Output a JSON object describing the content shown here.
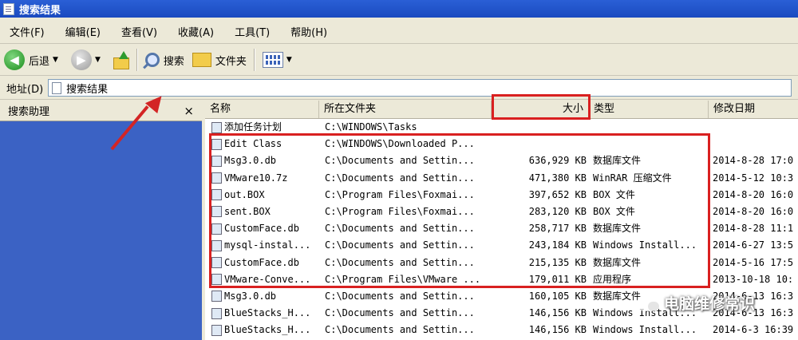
{
  "window": {
    "title": "搜索结果"
  },
  "menu": [
    "文件(F)",
    "编辑(E)",
    "查看(V)",
    "收藏(A)",
    "工具(T)",
    "帮助(H)"
  ],
  "toolbar": {
    "back": "后退",
    "search": "搜索",
    "folders": "文件夹"
  },
  "address": {
    "label": "地址(D)",
    "value": "搜索结果"
  },
  "search_pane": {
    "title": "搜索助理",
    "close": "×"
  },
  "columns": {
    "name": "名称",
    "folder": "所在文件夹",
    "size": "大小",
    "type": "类型",
    "modified": "修改日期"
  },
  "files": [
    {
      "name": "添加任务计划",
      "folder": "C:\\WINDOWS\\Tasks",
      "size": "",
      "type": "",
      "modified": ""
    },
    {
      "name": "Edit Class",
      "folder": "C:\\WINDOWS\\Downloaded P...",
      "size": "",
      "type": "",
      "modified": ""
    },
    {
      "name": "Msg3.0.db",
      "folder": "C:\\Documents and Settin...",
      "size": "636,929 KB",
      "type": "数据库文件",
      "modified": "2014-8-28 17:0"
    },
    {
      "name": "VMware10.7z",
      "folder": "C:\\Documents and Settin...",
      "size": "471,380 KB",
      "type": "WinRAR 压缩文件",
      "modified": "2014-5-12 10:3"
    },
    {
      "name": "out.BOX",
      "folder": "C:\\Program Files\\Foxmai...",
      "size": "397,652 KB",
      "type": "BOX 文件",
      "modified": "2014-8-20 16:0"
    },
    {
      "name": "sent.BOX",
      "folder": "C:\\Program Files\\Foxmai...",
      "size": "283,120 KB",
      "type": "BOX 文件",
      "modified": "2014-8-20 16:0"
    },
    {
      "name": "CustomFace.db",
      "folder": "C:\\Documents and Settin...",
      "size": "258,717 KB",
      "type": "数据库文件",
      "modified": "2014-8-28 11:1"
    },
    {
      "name": "mysql-instal...",
      "folder": "C:\\Documents and Settin...",
      "size": "243,184 KB",
      "type": "Windows Install...",
      "modified": "2014-6-27 13:5"
    },
    {
      "name": "CustomFace.db",
      "folder": "C:\\Documents and Settin...",
      "size": "215,135 KB",
      "type": "数据库文件",
      "modified": "2014-5-16 17:5"
    },
    {
      "name": "VMware-Conve...",
      "folder": "C:\\Program Files\\VMware ...",
      "size": "179,011 KB",
      "type": "应用程序",
      "modified": "2013-10-18 10:"
    },
    {
      "name": "Msg3.0.db",
      "folder": "C:\\Documents and Settin...",
      "size": "160,105 KB",
      "type": "数据库文件",
      "modified": "2014-6-13 16:3"
    },
    {
      "name": "BlueStacks_H...",
      "folder": "C:\\Documents and Settin...",
      "size": "146,156 KB",
      "type": "Windows Install...",
      "modified": "2014-6-13 16:3"
    },
    {
      "name": "BlueStacks_H...",
      "folder": "C:\\Documents and Settin...",
      "size": "146,156 KB",
      "type": "Windows Install...",
      "modified": "2014-6-3 16:39"
    }
  ],
  "watermark": "电脑维修常识",
  "colors": {
    "title_bar": "#1a4ac0",
    "search_pane": "#3b62c4",
    "highlight": "#d92020"
  },
  "icons": {
    "back": "back-arrow-icon",
    "forward": "forward-arrow-icon",
    "up": "up-folder-icon",
    "search": "search-icon",
    "folders": "folder-icon",
    "views": "views-icon",
    "arrow": "red-arrow-icon"
  }
}
